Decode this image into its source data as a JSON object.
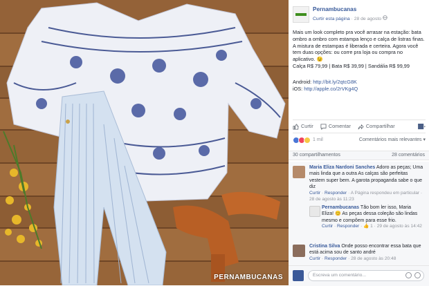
{
  "page": {
    "name": "Pernambucanas",
    "follow_label": "Curtir esta página",
    "separator": " · ",
    "date": "28 de agosto",
    "globe_icon": "globe-icon"
  },
  "post": {
    "text": "Mais um look completo pra você arrasar na estação: bata ombro a ombro com estampa lenço e calça de listras finas. A mistura de estampas é liberada e certeira. Agora você tem duas opções: ou corre pra loja ou compra no aplicativo. 😉\nCalça R$ 79,99 | Bata R$ 39,99 | Sandália R$ 99,99",
    "android_label": "Android:",
    "android_url": "http://bit.ly/2qtcG8K",
    "ios_label": "iOS:",
    "ios_url": "http://apple.co/2rVKg4Q"
  },
  "actions": {
    "like": "Curtir",
    "comment": "Comentar",
    "share": "Compartilhar"
  },
  "reactions": {
    "count": "1 mil",
    "sort": "Comentários mais relevantes ▾"
  },
  "counts": {
    "shares": "30 compartilhamentos",
    "comments": "28 comentários"
  },
  "comments": [
    {
      "author": "Maria Eliza Nardoni Sanches",
      "text": "Adoro as peças; Uma mais linda que a outra As calças são perfeitas vestem super bem. A garota propaganda sabe o que diz",
      "like": "Curtir",
      "reply": "Responder",
      "extra": " · A Página respondeu em particular · 28 de agosto às 11:23",
      "avatar_color": "#b58a6a"
    },
    {
      "author": "Pernambucanas",
      "text": "Tão bom ler isso, Maria Eliza! 😊 As peças dessa coleção são lindas mesmo e compõem para esse frio.",
      "like": "Curtir",
      "reply": "Responder",
      "extra": " · 👍 1 · 29 de agosto às 14:42",
      "avatar_color": "#e8e8e8"
    },
    {
      "author": "Cristina Silva",
      "text": "Onde posso encontrar essa bata que está acima sou de santo andré",
      "like": "Curtir",
      "reply": "Responder",
      "extra": " · 28 de agosto às 20:48",
      "avatar_color": "#8b6d5c"
    }
  ],
  "composer": {
    "placeholder": "Escreva um comentário..."
  },
  "photo": {
    "watermark": "PERNAMBUCANAS"
  },
  "colors": {
    "link": "#365899",
    "brand_green": "#3f8f1f",
    "wood": "#9a6a3e",
    "sandal": "#c1672a"
  }
}
